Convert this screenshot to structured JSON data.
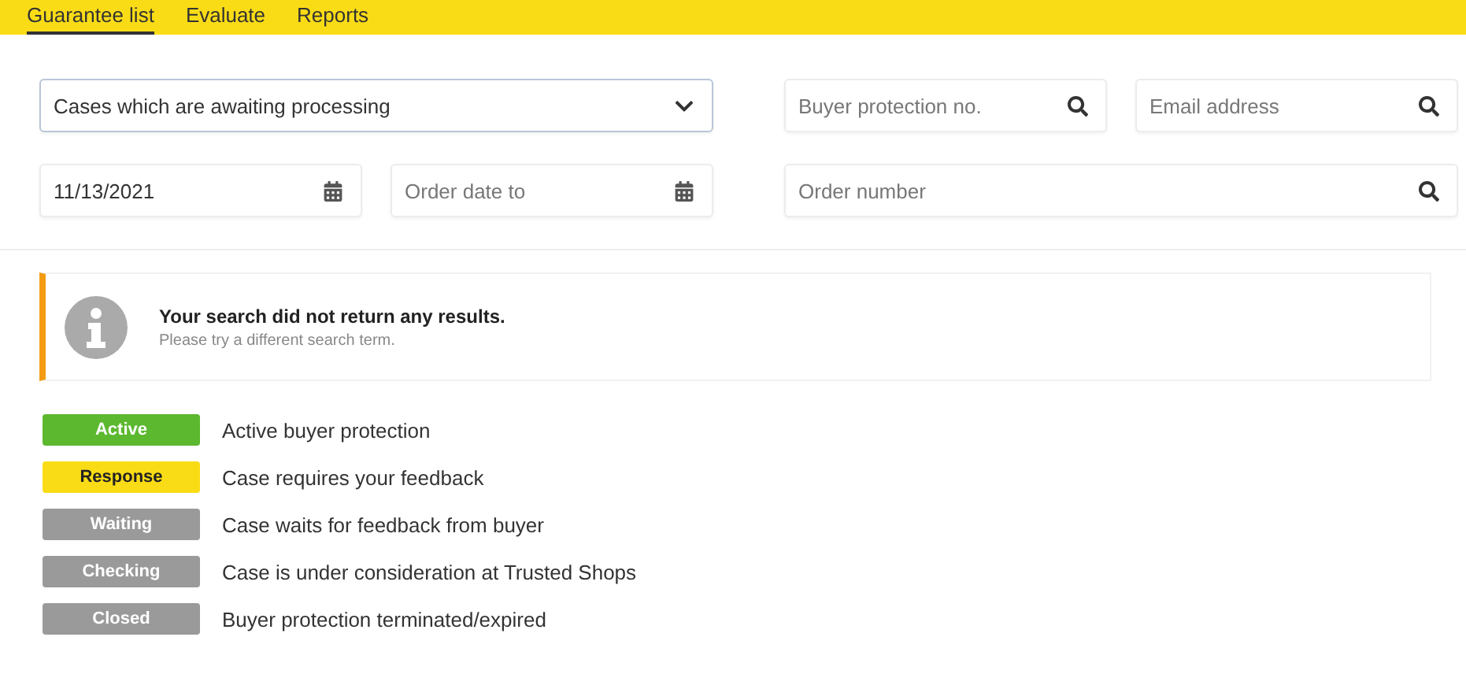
{
  "tabs": [
    {
      "label": "Guarantee list",
      "selected": true
    },
    {
      "label": "Evaluate",
      "selected": false
    },
    {
      "label": "Reports",
      "selected": false
    }
  ],
  "filters": {
    "status_select": {
      "value": "Cases which are awaiting processing"
    },
    "buyer_protection_no": {
      "placeholder": "Buyer protection no."
    },
    "email": {
      "placeholder": "Email address"
    },
    "order_date_from": {
      "value": "11/13/2021"
    },
    "order_date_to": {
      "placeholder": "Order date to"
    },
    "order_number": {
      "placeholder": "Order number"
    }
  },
  "alert": {
    "title": "Your search did not return any results.",
    "message": "Please try a different search term."
  },
  "legend": [
    {
      "badge": "Active",
      "color": "#5cb82f",
      "description": "Active buyer protection"
    },
    {
      "badge": "Response",
      "color": "#fadc16",
      "description": "Case requires your feedback"
    },
    {
      "badge": "Waiting",
      "color": "#9a9a9a",
      "description": "Case waits for feedback from buyer"
    },
    {
      "badge": "Checking",
      "color": "#9a9a9a",
      "description": "Case is under consideration at Trusted Shops"
    },
    {
      "badge": "Closed",
      "color": "#9a9a9a",
      "description": "Buyer protection terminated/expired"
    }
  ]
}
